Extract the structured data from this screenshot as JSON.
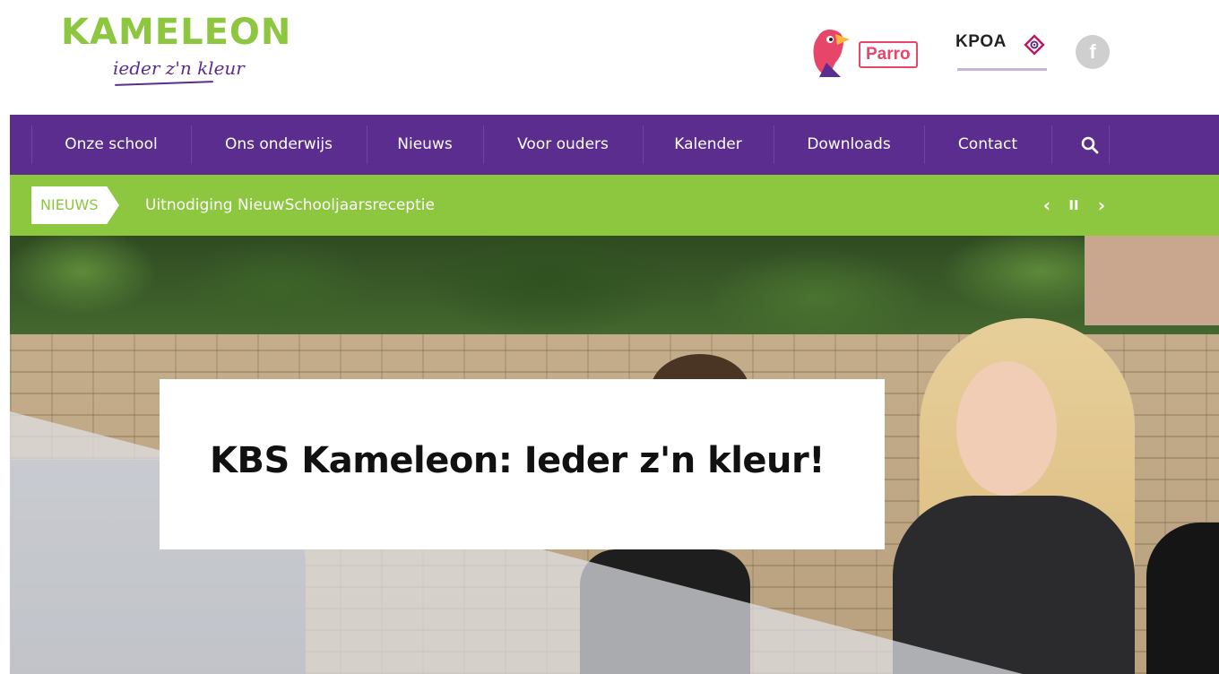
{
  "brand": {
    "name": "KAMELEON",
    "tagline": "ieder z'n kleur",
    "green": "#8dc63f",
    "purple": "#5b2d8e"
  },
  "partners": {
    "parro_label": "Parro",
    "kpoa_label": "KPOA",
    "facebook_icon": "facebook-icon"
  },
  "nav": {
    "items": [
      {
        "label": "Onze school"
      },
      {
        "label": "Ons onderwijs"
      },
      {
        "label": "Nieuws"
      },
      {
        "label": "Voor ouders"
      },
      {
        "label": "Kalender"
      },
      {
        "label": "Downloads"
      },
      {
        "label": "Contact"
      }
    ],
    "search_icon": "search-icon"
  },
  "news_ticker": {
    "tag": "NIEUWS",
    "headline": "Uitnodiging NieuwSchooljaarsreceptie",
    "prev": "‹",
    "pause": "II",
    "next": "›"
  },
  "hero": {
    "title": "KBS Kameleon: Ieder z'n kleur!"
  }
}
